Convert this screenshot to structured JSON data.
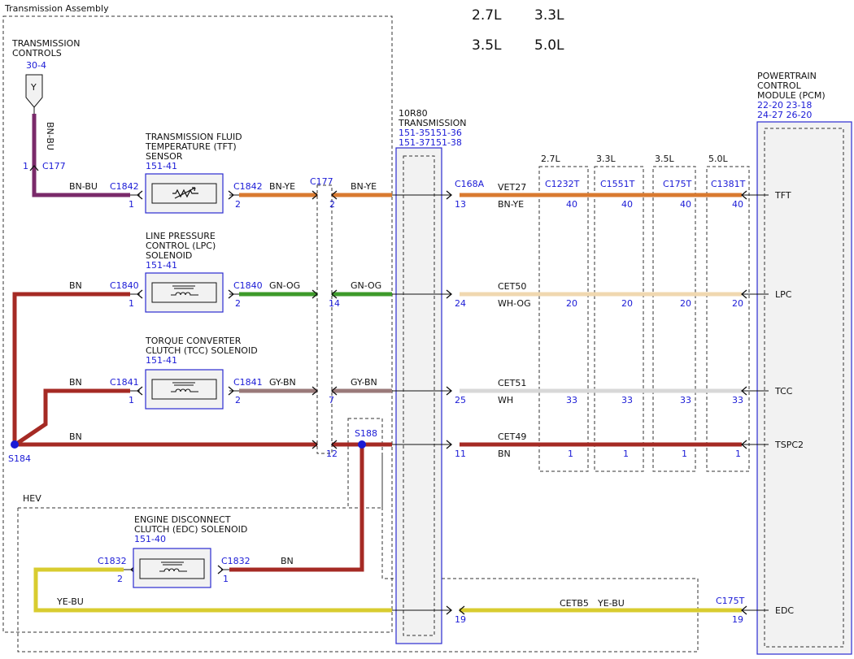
{
  "title": "Transmission Assembly",
  "engines": [
    "2.7L",
    "3.3L",
    "3.5L",
    "5.0L"
  ],
  "transmission_controls": {
    "line1": "TRANSMISSION",
    "line2": "CONTROLS",
    "ref": "30-4",
    "marker": "Y"
  },
  "tft_sensor": {
    "line1": "TRANSMISSION FLUID",
    "line2": "TEMPERATURE (TFT)",
    "line3": "SENSOR",
    "ref": "151-41"
  },
  "lpc_solenoid": {
    "line1": "LINE PRESSURE",
    "line2": "CONTROL (LPC)",
    "line3": "SOLENOID",
    "ref": "151-41"
  },
  "tcc_solenoid": {
    "line1": "TORQUE CONVERTER",
    "line2": "CLUTCH (TCC) SOLENOID",
    "ref": "151-41"
  },
  "edc_solenoid": {
    "line1": "ENGINE DISCONNECT",
    "line2": "CLUTCH (EDC) SOLENOID",
    "ref": "151-40"
  },
  "transmission_10r80": {
    "line1": "10R80",
    "line2": "TRANSMISSION",
    "ref1": "151-35151-36",
    "ref2": "151-37151-38"
  },
  "pcm": {
    "line1": "POWERTRAIN",
    "line2": "CONTROL",
    "line3": "MODULE (PCM)",
    "ref1": "22-20 23-18",
    "ref2": "24-27 26-20"
  },
  "hev_label": "HEV",
  "splices": [
    "S184",
    "S188"
  ],
  "connectors": {
    "c177": "C177",
    "c1842": "C1842",
    "c1840": "C1840",
    "c1841": "C1841",
    "c1832": "C1832",
    "c168a": "C168A",
    "c175t": "C175T",
    "c1232t": "C1232T",
    "c1551t": "C1551T",
    "c1381t": "C1381T"
  },
  "engine_connectors": [
    {
      "engine": "2.7L",
      "connector": "C1232T"
    },
    {
      "engine": "3.3L",
      "connector": "C1551T"
    },
    {
      "engine": "3.5L",
      "connector": "C175T"
    },
    {
      "engine": "5.0L",
      "connector": "C1381T"
    }
  ],
  "circuits": [
    {
      "signal": "TFT",
      "circuit": "VET27",
      "pcm_wire": "BN-YE",
      "trans_wire": "BN-YE",
      "comp_wire": "BN-YE",
      "ground_wire": "BN-BU",
      "c177_pin": "2",
      "trans_pin": "13",
      "pcm_pin": "40",
      "comp_pin_left": "1",
      "comp_pin_right": "2"
    },
    {
      "signal": "LPC",
      "circuit": "CET50",
      "pcm_wire": "WH-OG",
      "trans_wire": "GN-OG",
      "comp_wire": "GN-OG",
      "ground_wire": "BN",
      "c177_pin": "14",
      "trans_pin": "24",
      "pcm_pin": "20",
      "comp_pin_left": "1",
      "comp_pin_right": "2"
    },
    {
      "signal": "TCC",
      "circuit": "CET51",
      "pcm_wire": "WH",
      "trans_wire": "GY-BN",
      "comp_wire": "GY-BN",
      "ground_wire": "BN",
      "c177_pin": "7",
      "trans_pin": "25",
      "pcm_pin": "33",
      "comp_pin_left": "1",
      "comp_pin_right": "2"
    },
    {
      "signal": "TSPC2",
      "circuit": "CET49",
      "pcm_wire": "BN",
      "trans_wire": "",
      "comp_wire": "",
      "ground_wire": "BN",
      "c177_pin": "12",
      "trans_pin": "11",
      "pcm_pin": "1"
    },
    {
      "signal": "EDC",
      "circuit": "CETB5",
      "pcm_wire": "YE-BU",
      "trans_wire": "YE-BU",
      "comp_wire": "BN",
      "ground_wire": "",
      "trans_pin": "19",
      "pcm_pin": "19",
      "comp_pin_left": "2",
      "comp_pin_right": "1"
    }
  ],
  "wire_colors": {
    "BN": "#a52a24",
    "BN-BU": "#7a2a6a",
    "BN-YE": "#d97a30",
    "GN-OG": "#3d9a2a",
    "GY-BN": "#9a7a7a",
    "WH-OG": "#f0d8b0",
    "WH": "#d8d8d8",
    "YE-BU": "#d8cc30"
  },
  "accent_blue": "#1a1ad6",
  "pins": {
    "p1": "1",
    "p2": "2"
  }
}
